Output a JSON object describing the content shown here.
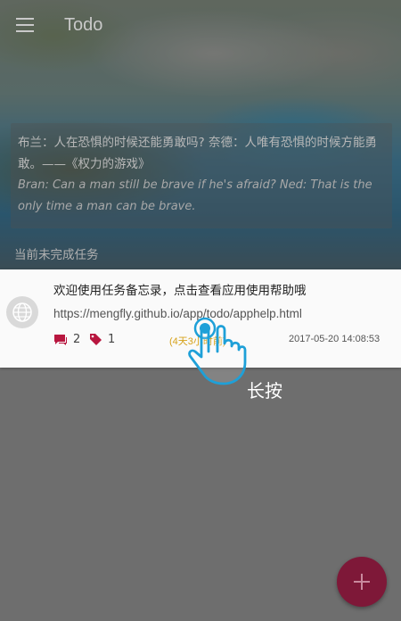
{
  "toolbar": {
    "title": "Todo",
    "menu_icon": "hamburger-menu-icon"
  },
  "quote": {
    "chinese": "布兰：人在恐惧的时候还能勇敢吗? 奈德：人唯有恐惧的时候方能勇敢。——《权力的游戏》",
    "english": "Bran: Can a man still be brave if he's afraid? Ned: That is the only time a man can be brave."
  },
  "section": {
    "label": "当前未完成任务"
  },
  "task": {
    "avatar_icon": "globe-icon",
    "title": "欢迎使用任务备忘录，点击查看应用使用帮助哦",
    "url": "https://mengfly.github.io/app/todo/apphelp.html",
    "comment_icon": "comment-icon",
    "comment_count": "2",
    "tag_icon": "tag-icon",
    "tag_count": "1",
    "time_relative": "(4天3小时前)",
    "time_absolute": "2017-05-20 14:08:53"
  },
  "gesture": {
    "icon": "hand-pointer-icon",
    "label": "长按"
  },
  "fab": {
    "icon": "plus-icon"
  },
  "colors": {
    "accent": "#7e1838",
    "comment_icon": "#b8163f",
    "tag_icon": "#b8163f",
    "relative_time": "#d6a21a",
    "hand_outline": "#1ea0d8"
  }
}
